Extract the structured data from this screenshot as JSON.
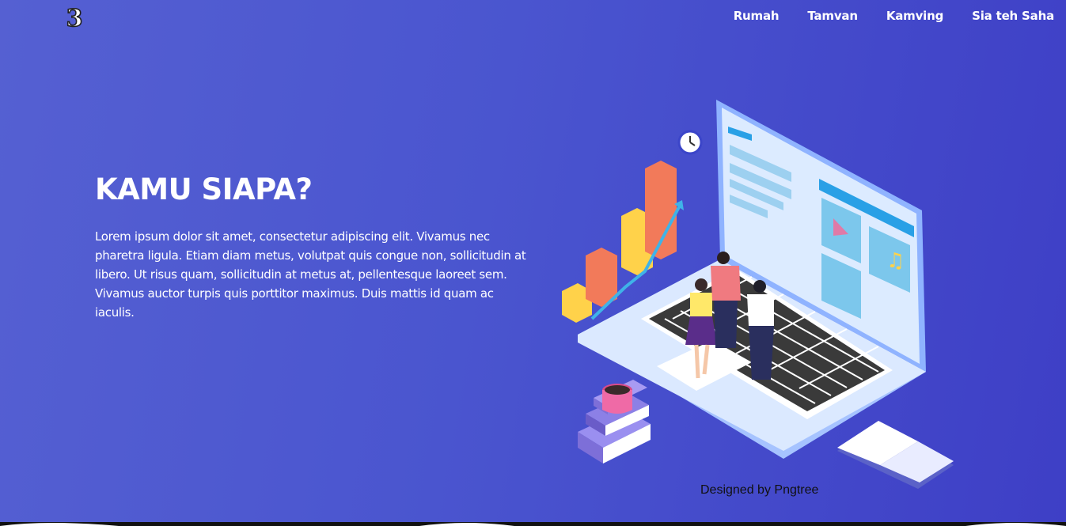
{
  "brand": {
    "logo_text": "3",
    "logo_icon": "three-logo-icon"
  },
  "nav": {
    "items": [
      {
        "label": "Rumah"
      },
      {
        "label": "Tamvan"
      },
      {
        "label": "Kamving"
      },
      {
        "label": "Sia teh Saha"
      }
    ]
  },
  "hero": {
    "title": "KAMU SIAPA?",
    "body": "Lorem ipsum dolor sit amet, consectetur adipiscing elit. Vivamus nec pharetra ligula. Etiam diam metus, volutpat quis congue non, sollicitudin at libero. Ut risus quam, sollicitudin at metus at, pellentesque laoreet sem. Vivamus auctor turpis quis porttitor maximus. Duis mattis id quam ac iaculis."
  },
  "illustration": {
    "name": "isometric-laptop-team-illustration",
    "credit": "Designed by Pngtree"
  },
  "colors": {
    "bg_start": "#5560d2",
    "bg_end": "#3e3fc6",
    "text": "#ffffff"
  }
}
